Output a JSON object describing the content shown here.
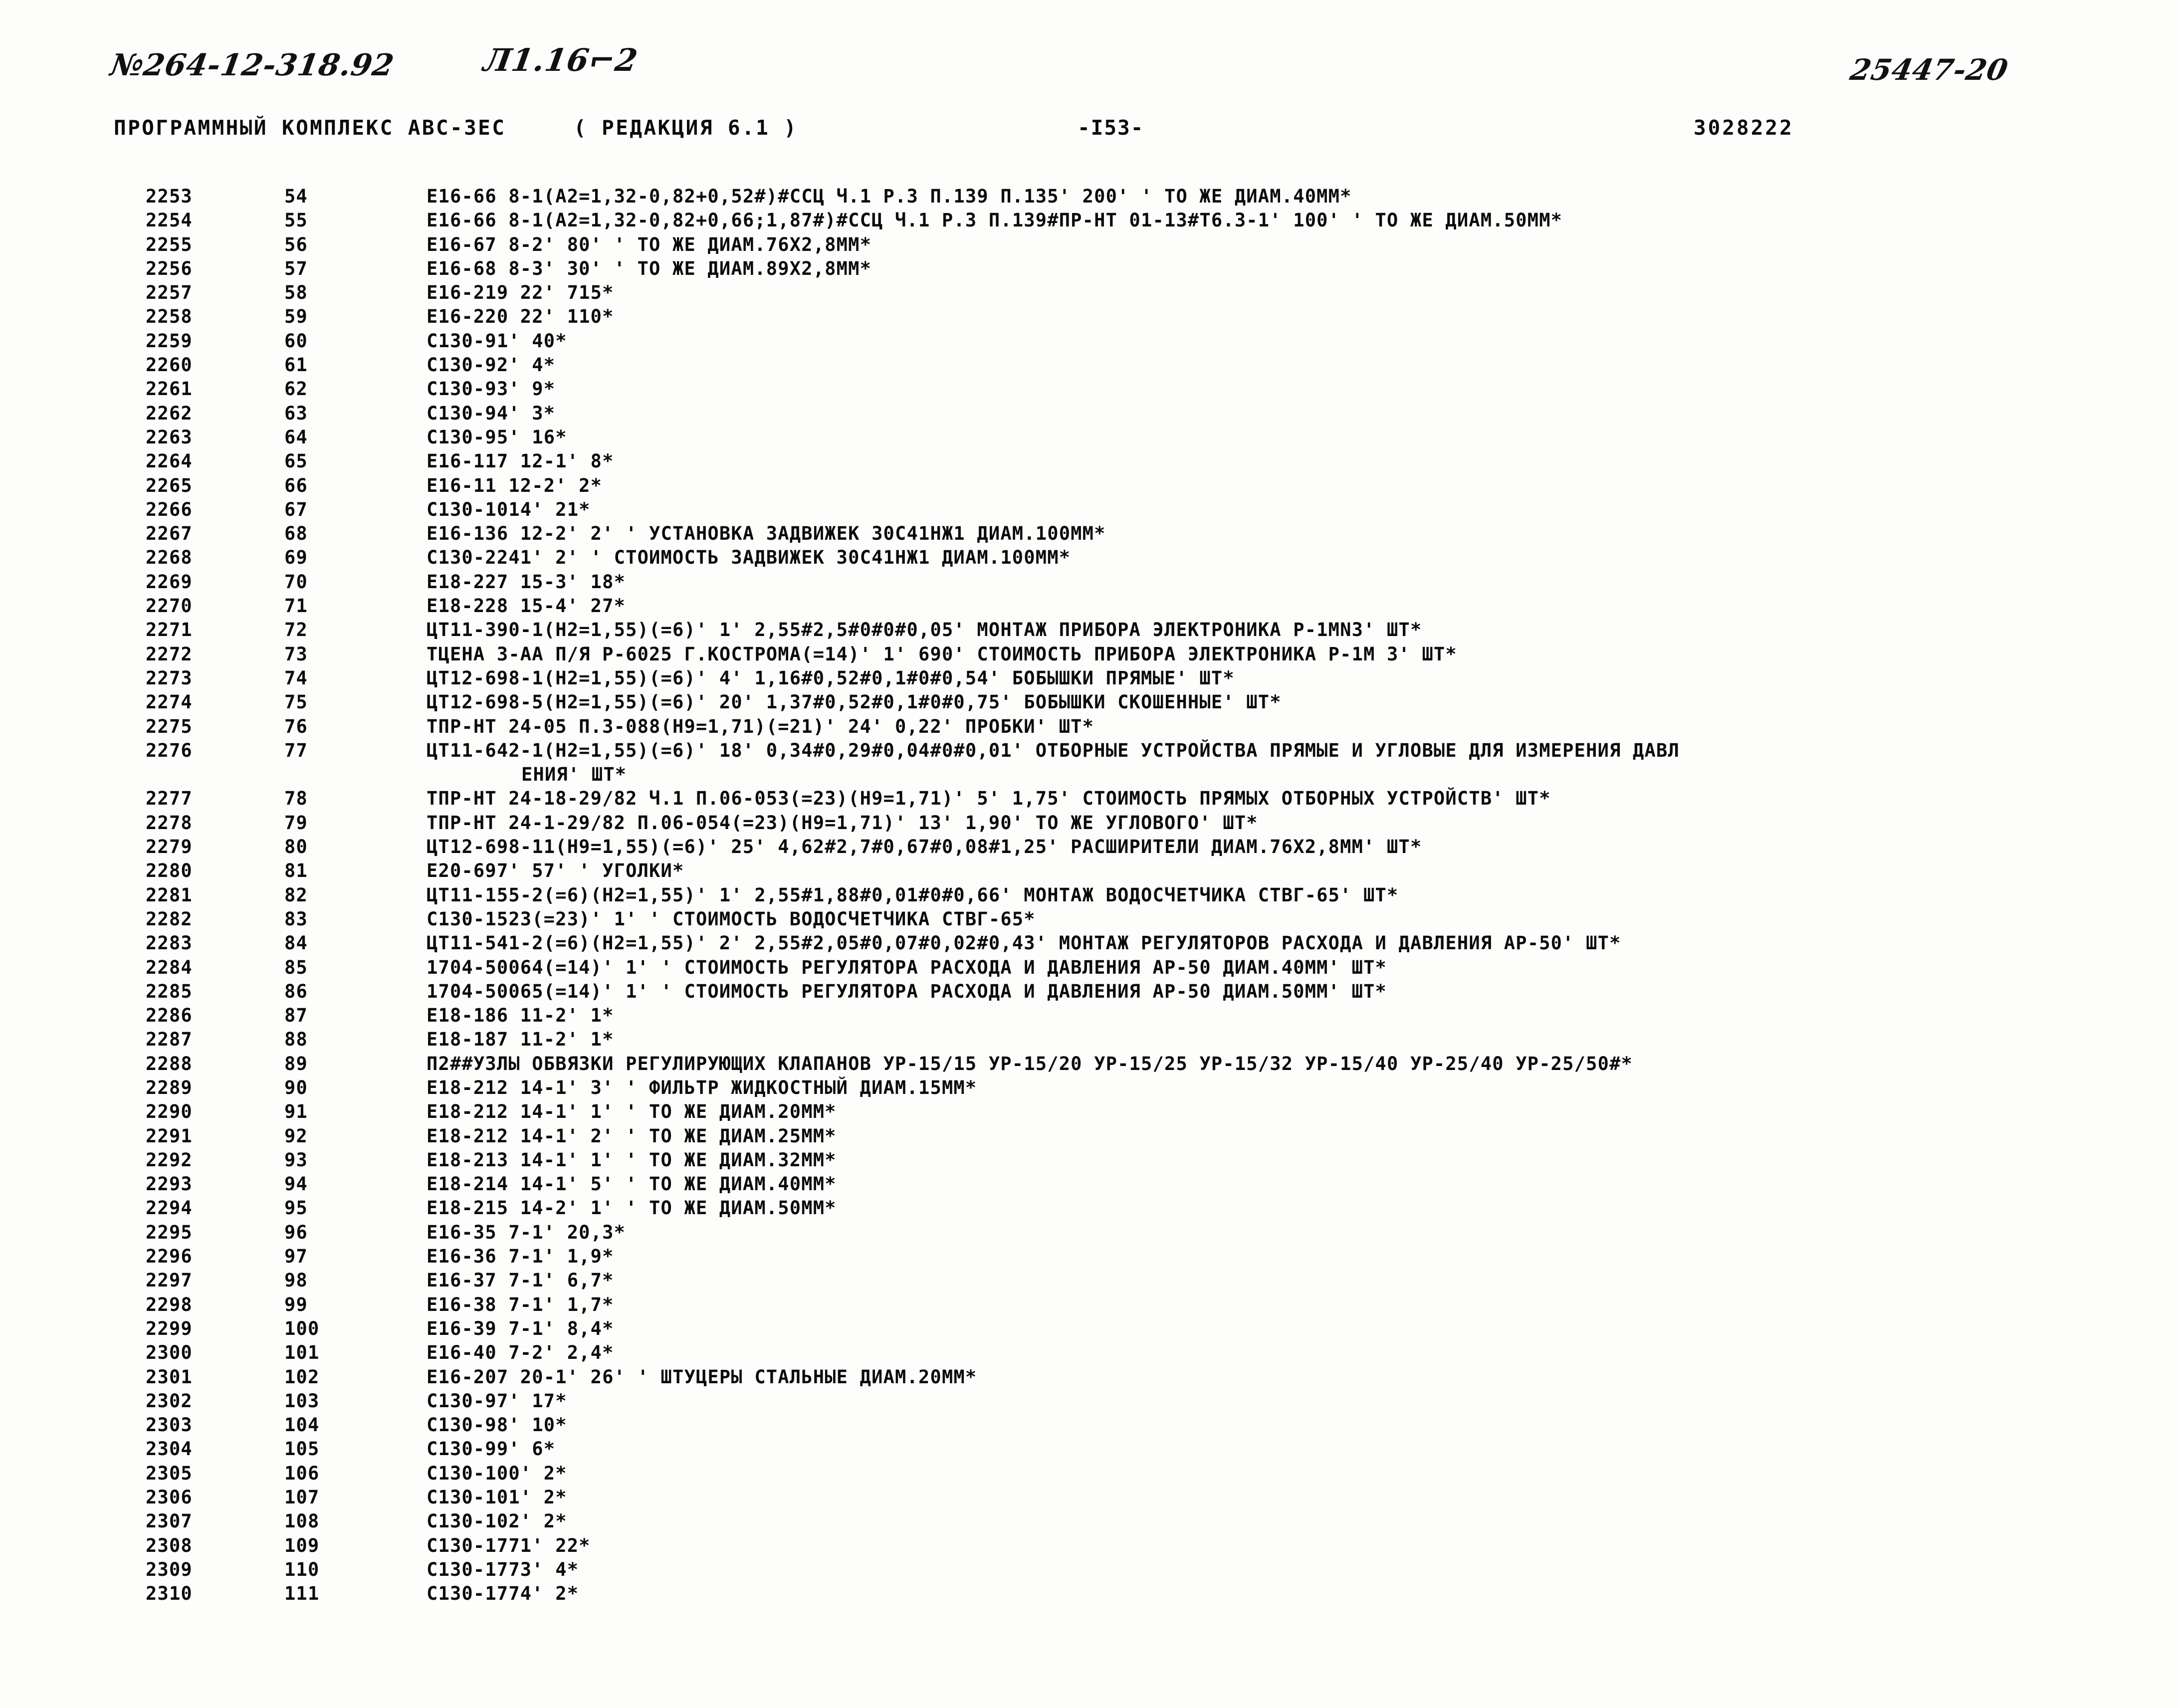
{
  "handwritten": {
    "doc_number": "№264-12-318.92",
    "sheet_mark": "Л1.16⌐2",
    "stamp_number": "25447-20"
  },
  "header": {
    "title": "ПРОГРАММНЫЙ КОМПЛЕКС АВС-3ЕС",
    "revision": "( РЕДАКЦИЯ  6.1  )",
    "page": "-I53-",
    "code": "3028222"
  },
  "listing": {
    "rows": [
      {
        "a": "2253",
        "b": "54",
        "c": "E16-66 8-1(A2=1,32-0,82+0,52#)#ССЦ Ч.1 Р.3 П.139 П.135' 200' ' ТО ЖЕ ДИАМ.40ММ*"
      },
      {
        "a": "2254",
        "b": "55",
        "c": "E16-66 8-1(A2=1,32-0,82+0,66;1,87#)#ССЦ Ч.1 Р.3 П.139#ПР-НТ 01-13#Т6.3-1' 100' ' ТО ЖЕ ДИАМ.50ММ*"
      },
      {
        "a": "2255",
        "b": "56",
        "c": "E16-67 8-2' 80' ' ТО ЖЕ ДИАМ.76Х2,8ММ*"
      },
      {
        "a": "2256",
        "b": "57",
        "c": "E16-68 8-3' 30' ' ТО ЖЕ ДИАМ.89Х2,8ММ*"
      },
      {
        "a": "2257",
        "b": "58",
        "c": "E16-219 22' 715*"
      },
      {
        "a": "2258",
        "b": "59",
        "c": "E16-220 22' 110*"
      },
      {
        "a": "2259",
        "b": "60",
        "c": "С130-91' 40*"
      },
      {
        "a": "2260",
        "b": "61",
        "c": "С130-92' 4*"
      },
      {
        "a": "2261",
        "b": "62",
        "c": "С130-93' 9*"
      },
      {
        "a": "2262",
        "b": "63",
        "c": "С130-94' 3*"
      },
      {
        "a": "2263",
        "b": "64",
        "c": "С130-95' 16*"
      },
      {
        "a": "2264",
        "b": "65",
        "c": "E16-117 12-1' 8*"
      },
      {
        "a": "2265",
        "b": "66",
        "c": "E16-11 12-2' 2*"
      },
      {
        "a": "2266",
        "b": "67",
        "c": "С130-1014' 21*"
      },
      {
        "a": "2267",
        "b": "68",
        "c": "E16-136 12-2' 2' ' УСТАНОВКА ЗАДВИЖЕК 30С41НЖ1 ДИАМ.100ММ*"
      },
      {
        "a": "2268",
        "b": "69",
        "c": "С130-2241' 2' ' СТОИМОСТЬ ЗАДВИЖЕК 30С41НЖ1 ДИАМ.100ММ*"
      },
      {
        "a": "2269",
        "b": "70",
        "c": "E18-227 15-3' 18*"
      },
      {
        "a": "2270",
        "b": "71",
        "c": "E18-228 15-4' 27*"
      },
      {
        "a": "2271",
        "b": "72",
        "c": "ЦТ11-390-1(Н2=1,55)(=6)' 1' 2,55#2,5#0#0#0,05' МОНТАЖ ПРИБОРА ЭЛЕКТРОНИКА Р-1МN3' ШТ*"
      },
      {
        "a": "2272",
        "b": "73",
        "c": "ТЦЕНА 3-АА П/Я Р-6025 Г.КОСТРОМА(=14)' 1' 690' СТОИМОСТЬ ПРИБОРА ЭЛЕКТРОНИКА Р-1М 3' ШТ*"
      },
      {
        "a": "2273",
        "b": "74",
        "c": "ЦТ12-698-1(Н2=1,55)(=6)' 4' 1,16#0,52#0,1#0#0,54' БОБЫШКИ ПРЯМЫЕ' ШТ*"
      },
      {
        "a": "2274",
        "b": "75",
        "c": "ЦТ12-698-5(Н2=1,55)(=6)' 20' 1,37#0,52#0,1#0#0,75' БОБЫШКИ СКОШЕННЫЕ' ШТ*"
      },
      {
        "a": "2275",
        "b": "76",
        "c": "ТПР-НТ 24-05 П.3-088(Н9=1,71)(=21)' 24' 0,22' ПРОБКИ' ШТ*"
      },
      {
        "a": "2276",
        "b": "77",
        "c": "ЦТ11-642-1(Н2=1,55)(=6)' 18' 0,34#0,29#0,04#0#0,01' ОТБОРНЫЕ УСТРОЙСТВА ПРЯМЫЕ И УГЛОВЫЕ ДЛЯ ИЗМЕРЕНИЯ ДАВЛ",
        "cont": "ЕНИЯ' ШТ*"
      },
      {
        "a": "2277",
        "b": "78",
        "c": "ТПР-НТ 24-18-29/82 Ч.1 П.06-053(=23)(Н9=1,71)' 5' 1,75' СТОИМОСТЬ ПРЯМЫХ ОТБОРНЫХ УСТРОЙСТВ' ШТ*"
      },
      {
        "a": "2278",
        "b": "79",
        "c": "ТПР-НТ 24-1-29/82 П.06-054(=23)(Н9=1,71)' 13' 1,90' ТО ЖЕ УГЛОВОГО' ШТ*"
      },
      {
        "a": "2279",
        "b": "80",
        "c": "ЦТ12-698-11(Н9=1,55)(=6)' 25' 4,62#2,7#0,67#0,08#1,25' РАСШИРИТЕЛИ ДИАМ.76Х2,8ММ' ШТ*"
      },
      {
        "a": "2280",
        "b": "81",
        "c": "E20-697' 57' ' УГОЛКИ*"
      },
      {
        "a": "2281",
        "b": "82",
        "c": "ЦТ11-155-2(=6)(Н2=1,55)' 1' 2,55#1,88#0,01#0#0,66' МОНТАЖ ВОДОСЧЕТЧИКА СТВГ-65' ШТ*"
      },
      {
        "a": "2282",
        "b": "83",
        "c": "С130-1523(=23)' 1' ' СТОИМОСТЬ ВОДОСЧЕТЧИКА СТВГ-65*"
      },
      {
        "a": "2283",
        "b": "84",
        "c": "ЦТ11-541-2(=6)(Н2=1,55)' 2' 2,55#2,05#0,07#0,02#0,43' МОНТАЖ РЕГУЛЯТОРОВ РАСХОДА И ДАВЛЕНИЯ АР-50' ШТ*"
      },
      {
        "a": "2284",
        "b": "85",
        "c": "1704-50064(=14)' 1' ' СТОИМОСТЬ РЕГУЛЯТОРА РАСХОДА И ДАВЛЕНИЯ АР-50 ДИАМ.40ММ' ШТ*"
      },
      {
        "a": "2285",
        "b": "86",
        "c": "1704-50065(=14)' 1' ' СТОИМОСТЬ РЕГУЛЯТОРА РАСХОДА И ДАВЛЕНИЯ АР-50 ДИАМ.50ММ' ШТ*"
      },
      {
        "a": "2286",
        "b": "87",
        "c": "E18-186 11-2' 1*"
      },
      {
        "a": "2287",
        "b": "88",
        "c": "E18-187 11-2' 1*"
      },
      {
        "a": "2288",
        "b": "89",
        "c": "П2##УЗЛЫ ОБВЯЗКИ РЕГУЛИРУЮЩИХ КЛАПАНОВ УР-15/15 УР-15/20 УР-15/25 УР-15/32 УР-15/40 УР-25/40 УР-25/50#*"
      },
      {
        "a": "2289",
        "b": "90",
        "c": "E18-212 14-1' 3' ' ФИЛЬТР ЖИДКОСТНЫЙ ДИАМ.15ММ*"
      },
      {
        "a": "2290",
        "b": "91",
        "c": "E18-212 14-1' 1' ' ТО ЖЕ ДИАМ.20ММ*"
      },
      {
        "a": "2291",
        "b": "92",
        "c": "E18-212 14-1' 2' ' ТО ЖЕ ДИАМ.25ММ*"
      },
      {
        "a": "2292",
        "b": "93",
        "c": "E18-213 14-1' 1' ' ТО ЖЕ ДИАМ.32ММ*"
      },
      {
        "a": "2293",
        "b": "94",
        "c": "E18-214 14-1' 5' ' ТО ЖЕ ДИАМ.40ММ*"
      },
      {
        "a": "2294",
        "b": "95",
        "c": "E18-215 14-2' 1' ' ТО ЖЕ ДИАМ.50ММ*"
      },
      {
        "a": "2295",
        "b": "96",
        "c": "E16-35 7-1' 20,3*"
      },
      {
        "a": "2296",
        "b": "97",
        "c": "E16-36 7-1' 1,9*"
      },
      {
        "a": "2297",
        "b": "98",
        "c": "E16-37 7-1' 6,7*"
      },
      {
        "a": "2298",
        "b": "99",
        "c": "E16-38 7-1' 1,7*"
      },
      {
        "a": "2299",
        "b": "100",
        "c": "E16-39 7-1' 8,4*"
      },
      {
        "a": "2300",
        "b": "101",
        "c": "E16-40 7-2' 2,4*"
      },
      {
        "a": "2301",
        "b": "102",
        "c": "E16-207 20-1' 26' ' ШТУЦЕРЫ СТАЛЬНЫЕ ДИАМ.20ММ*"
      },
      {
        "a": "2302",
        "b": "103",
        "c": "С130-97' 17*"
      },
      {
        "a": "2303",
        "b": "104",
        "c": "С130-98' 10*"
      },
      {
        "a": "2304",
        "b": "105",
        "c": "С130-99' 6*"
      },
      {
        "a": "2305",
        "b": "106",
        "c": "С130-100' 2*"
      },
      {
        "a": "2306",
        "b": "107",
        "c": "С130-101' 2*"
      },
      {
        "a": "2307",
        "b": "108",
        "c": "С130-102' 2*"
      },
      {
        "a": "2308",
        "b": "109",
        "c": "С130-1771' 22*"
      },
      {
        "a": "2309",
        "b": "110",
        "c": "С130-1773' 4*"
      },
      {
        "a": "2310",
        "b": "111",
        "c": "С130-1774' 2*"
      }
    ]
  }
}
